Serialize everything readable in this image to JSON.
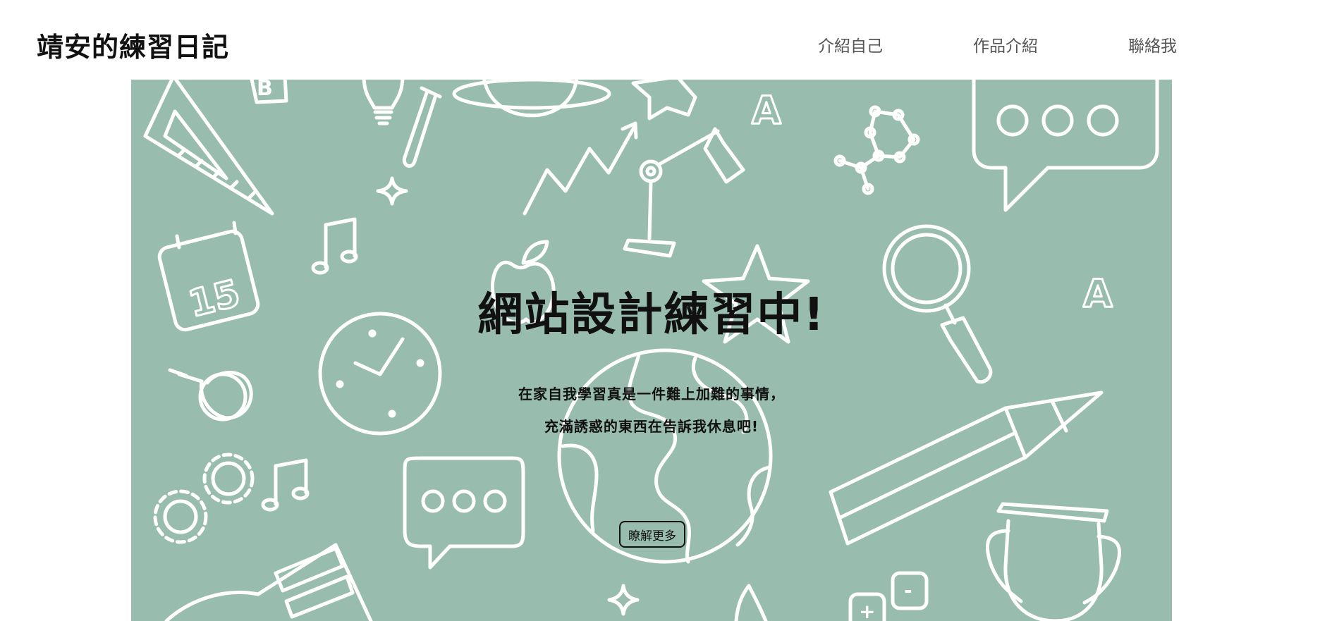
{
  "site": {
    "title": "靖安的練習日記"
  },
  "nav": {
    "items": [
      "介紹自己",
      "作品介紹",
      "聯絡我"
    ]
  },
  "hero": {
    "title": "網站設計練習中!",
    "line1": "在家自我學習真是一件難上加難的事情，",
    "line2": "充滿誘惑的東西在告訴我休息吧!",
    "button_label": "瞭解更多",
    "background_color": "#98bdae",
    "doodle_color": "#ffffff",
    "doodles": {
      "calendar_day": "15",
      "letter_a": "A",
      "letter_b": "B",
      "calc_plus": "+",
      "calc_minus": "-"
    }
  }
}
